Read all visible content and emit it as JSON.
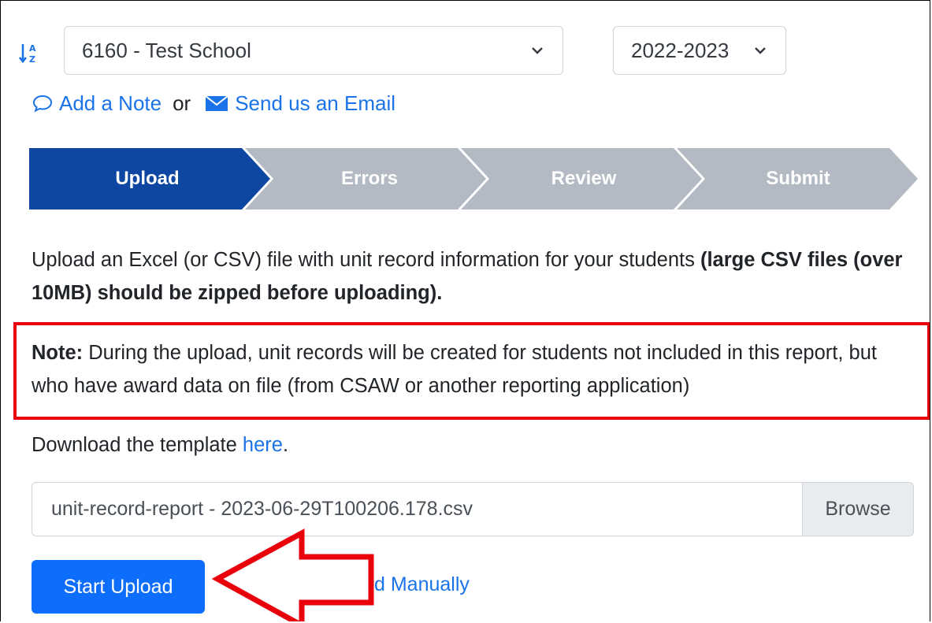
{
  "filters": {
    "school_selected": "6160 - Test School",
    "year_selected": "2022-2023"
  },
  "actions": {
    "add_note": "Add a Note",
    "or": "or",
    "send_email": "Send us an Email"
  },
  "stepper": {
    "steps": [
      "Upload",
      "Errors",
      "Review",
      "Submit"
    ],
    "active_color": "#0d47a1",
    "inactive_color": "#b3bac3"
  },
  "instructions": {
    "text": "Upload an Excel (or CSV) file with unit record information for your students ",
    "bold": "(large CSV files (over 10MB) should be zipped before uploading)."
  },
  "note": {
    "label": "Note:",
    "text": " During the upload, unit records will be created for students not included in this report, but who have award data on file (from CSAW or another reporting application)"
  },
  "template": {
    "prefix": "Download the template ",
    "link": "here",
    "suffix": "."
  },
  "file": {
    "name": "unit-record-report - 2023-06-29T100206.178.csv",
    "browse": "Browse"
  },
  "buttons": {
    "start_upload": "Start Upload",
    "manual_visible": "d Manually"
  },
  "annotation_colors": {
    "highlight": "#e8000b"
  }
}
